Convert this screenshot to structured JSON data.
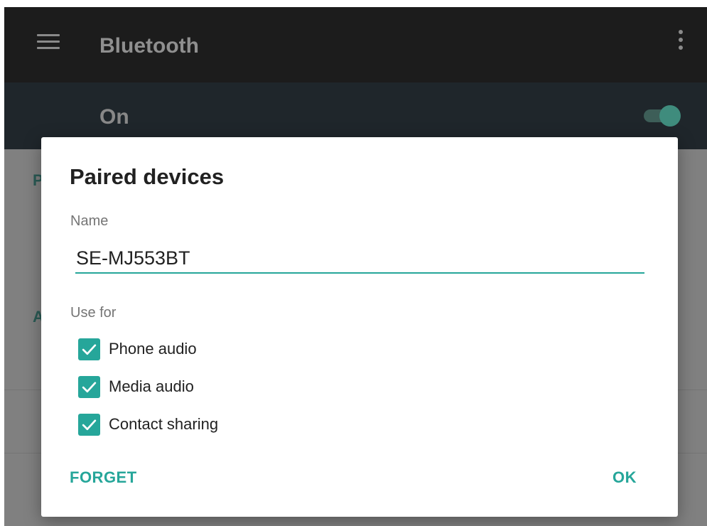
{
  "toolbar": {
    "title": "Bluetooth",
    "menu_icon": "menu-icon",
    "overflow_icon": "more-vert-icon"
  },
  "status": {
    "label": "On",
    "switch_on": true
  },
  "background": {
    "partial_letter_1": "P",
    "partial_letter_2": "A"
  },
  "dialog": {
    "title": "Paired devices",
    "name_label": "Name",
    "name_value": "SE-MJ553BT",
    "use_for_label": "Use for",
    "options": [
      {
        "label": "Phone audio",
        "checked": true
      },
      {
        "label": "Media audio",
        "checked": true
      },
      {
        "label": "Contact sharing",
        "checked": true
      }
    ],
    "forget_label": "FORGET",
    "ok_label": "OK"
  },
  "colors": {
    "accent": "#26a69a",
    "toolbar": "#1c1c1c",
    "status_bar": "#1f262b",
    "scrim": "#808080"
  }
}
